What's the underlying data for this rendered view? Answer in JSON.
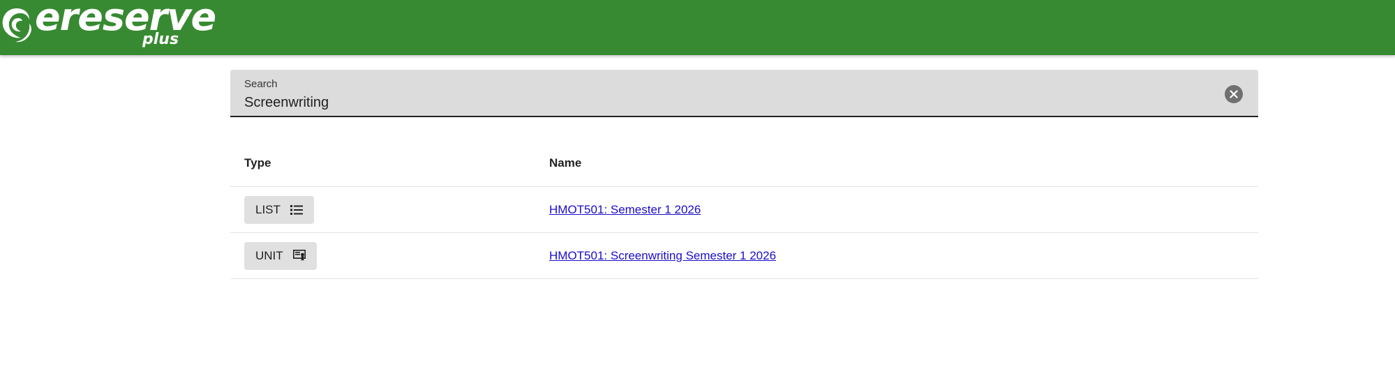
{
  "header": {
    "brand": "ereserve",
    "brand_sub": "plus",
    "bg_color": "#378a31"
  },
  "search": {
    "label": "Search",
    "value": "Screenwriting",
    "clear_icon": "close-circle-icon"
  },
  "table": {
    "columns": [
      "Type",
      "Name"
    ],
    "rows": [
      {
        "type": "LIST",
        "type_icon": "list-icon",
        "name": "HMOT501: Semester 1 2026"
      },
      {
        "type": "UNIT",
        "type_icon": "unit-icon",
        "name": "HMOT501: Screenwriting Semester 1 2026"
      }
    ]
  },
  "colors": {
    "link": "#1a0dcc",
    "chip_bg": "#e0e0e0",
    "search_bg": "#dcdcdc"
  }
}
